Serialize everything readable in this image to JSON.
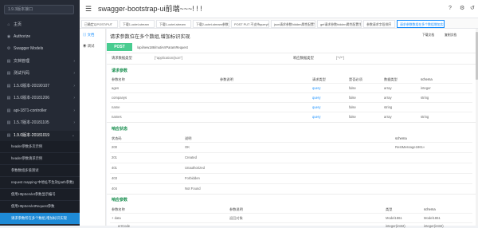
{
  "sidebar": {
    "search_placeholder": "1.9.3版本接口",
    "items": [
      {
        "icon": "⌂",
        "label": "主页",
        "arrow": ""
      },
      {
        "icon": "◉",
        "label": "Authorize",
        "arrow": ""
      },
      {
        "icon": "⚙",
        "label": "Swagger Models",
        "arrow": ""
      },
      {
        "icon": "▤",
        "label": "文档管理",
        "arrow": "›"
      },
      {
        "icon": "▤",
        "label": "测试代码",
        "arrow": "›"
      },
      {
        "icon": "▤",
        "label": "1.5.0版本-20190107",
        "arrow": "›"
      },
      {
        "icon": "▤",
        "label": "1.5.0版本-20181206",
        "arrow": "›"
      },
      {
        "icon": "▤",
        "label": "api-1871-controller",
        "arrow": "›"
      },
      {
        "icon": "▤",
        "label": "1.5.7版本-20181105",
        "arrow": "›"
      },
      {
        "icon": "▤",
        "label": "1.9.0版本-20181019",
        "arrow": "⌄"
      }
    ],
    "subitems": [
      "header参数多次示例",
      "header参数请求示例",
      "参数数组多值测试",
      "request mapping 中地址不生效(path参数)",
      "使用HttpServlet参数显示编号",
      "使用HttpServletRequest参数",
      "请求参数所在多个数组,增加标识实现"
    ]
  },
  "header": {
    "menu_icon": "☰",
    "title": "swagger-bootstrap-ui前端~~~! ! !",
    "icons": [
      "?",
      "⚙",
      "↺"
    ]
  },
  "tabs": [
    "已确定以POST/PUT",
    "下载1-octet-stream",
    "下载1-octet-stream",
    "下载2-octet-stream参数",
    "POST PUT 不支持query参数",
    "json请求参数hidden属性配置生效",
    "get请求参数hidden属性配置生效",
    "参数请求字段排序",
    "请求参数数组在多个数组增加实体"
  ],
  "left_pane": {
    "doc": "文档",
    "debug": "调试"
  },
  "api": {
    "title": "请求参数位在多个数组,增加标识实现",
    "download_label": "下载文档",
    "copy_label": "复制文档",
    "method": "POST",
    "path": "/api/new186/mutiArrParamRequest",
    "req_type_label": "请求数据类型",
    "req_type_value": "[\"application/json\"]",
    "resp_type_label": "响应数据类型",
    "resp_type_value": "[\"*/*\"]"
  },
  "request_params": {
    "title": "请求参数",
    "headers": [
      "参数名称",
      "参数说明",
      "请求类型",
      "是否必须",
      "数据类型",
      "schema"
    ],
    "rows": [
      [
        "ages",
        "",
        "query",
        "false",
        "array",
        "integer"
      ],
      [
        "companys",
        "",
        "query",
        "false",
        "array",
        "string"
      ],
      [
        "name",
        "",
        "query",
        "false",
        "string",
        ""
      ],
      [
        "names",
        "",
        "query",
        "false",
        "array",
        "string"
      ]
    ]
  },
  "response_status": {
    "title": "响应状态",
    "headers": [
      "状态码",
      "说明",
      "schema"
    ],
    "rows": [
      [
        "200",
        "OK",
        "RestMessage1861«"
      ],
      [
        "201",
        "Created",
        ""
      ],
      [
        "401",
        "Unauthorized",
        ""
      ],
      [
        "403",
        "Forbidden",
        ""
      ],
      [
        "404",
        "Not Found",
        ""
      ]
    ]
  },
  "response_params": {
    "title": "响应参数",
    "headers": [
      "参数名称",
      "参数说明",
      "类型",
      "schema"
    ],
    "rows": [
      [
        "data",
        "返回对象",
        "Model1861",
        "Model1861"
      ],
      [
        "errCode",
        "",
        "integer(int32)",
        "integer(int32)"
      ]
    ]
  },
  "colors": {
    "sidebar_bg": "#252a35",
    "active_item": "#1e8ad6",
    "post_green": "#49cc90",
    "section_green": "#1a8f50",
    "link_blue": "#1890ff"
  }
}
